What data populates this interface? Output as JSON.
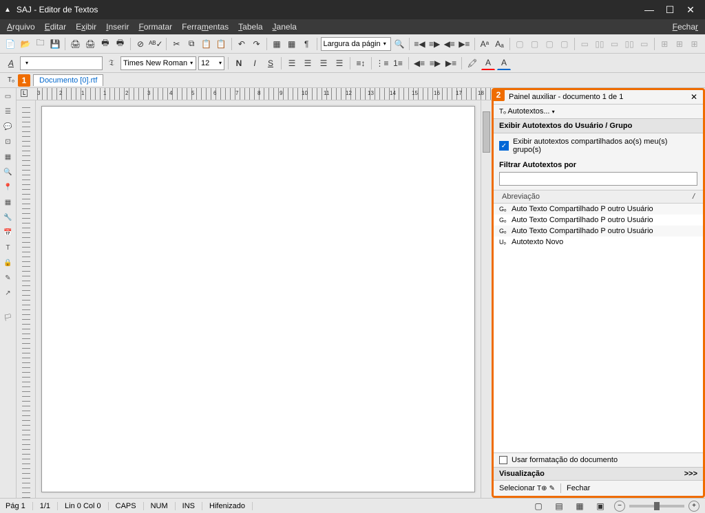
{
  "window": {
    "title": "SAJ - Editor de Textos"
  },
  "menu": {
    "arquivo": "Arquivo",
    "editar": "Editar",
    "exibir": "Exibir",
    "inserir": "Inserir",
    "formatar": "Formatar",
    "ferramentas": "Ferramentas",
    "tabela": "Tabela",
    "janela": "Janela",
    "fechar": "Fechar"
  },
  "toolbar2": {
    "font_name": "Times New Roman",
    "font_size": "12",
    "page_width": "Largura da págin"
  },
  "tabs": {
    "marker1": "1",
    "doc_name": "Documento [0].rtf"
  },
  "ruler_numbers": [
    "3",
    "2",
    "1",
    "1",
    "2",
    "3",
    "4",
    "5",
    "6",
    "7",
    "8",
    "9",
    "10",
    "11",
    "12",
    "13",
    "14",
    "15",
    "16",
    "17",
    "18"
  ],
  "sidepanel": {
    "marker2": "2",
    "title": "Painel auxiliar - documento 1 de 1",
    "autotextos": "Autotextos...",
    "section1": "Exibir Autotextos do Usuário / Grupo",
    "checkbox1": "Exibir autotextos compartilhados ao(s) meu(s) grupo(s)",
    "filter_label": "Filtrar Autotextos por",
    "list_header": "Abreviação",
    "items": [
      {
        "icon": "Gₒ",
        "text": "Auto Texto Compartilhado P outro Usuário"
      },
      {
        "icon": "Gₒ",
        "text": "Auto Texto Compartilhado P outro Usuário"
      },
      {
        "icon": "Gₒ",
        "text": "Auto Texto Compartilhado P outro Usuário"
      },
      {
        "icon": "Uₒ",
        "text": "Autotexto Novo"
      }
    ],
    "usar_format": "Usar formatação do documento",
    "visualizacao": "Visualização",
    "vis_more": ">>>",
    "selecionar": "Selecionar",
    "fechar": "Fechar"
  },
  "status": {
    "pag": "Pág 1",
    "pages": "1/1",
    "lincol": "Lin 0  Col 0",
    "caps": "CAPS",
    "num": "NUM",
    "ins": "INS",
    "hif": "Hifenizado"
  }
}
